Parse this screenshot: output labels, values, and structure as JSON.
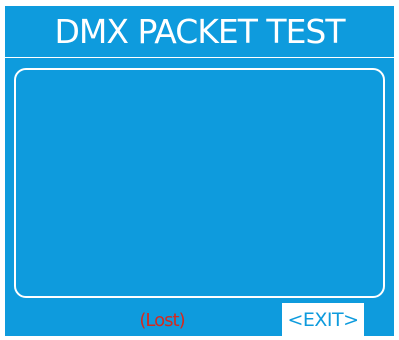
{
  "header": {
    "title": "DMX PACKET TEST"
  },
  "display": {
    "content": ""
  },
  "footer": {
    "status_text": "(Lost)",
    "exit_label": "<EXIT>"
  },
  "colors": {
    "background": "#0E9BDD",
    "foreground": "#FFFFFF",
    "status": "#D42A1F"
  }
}
